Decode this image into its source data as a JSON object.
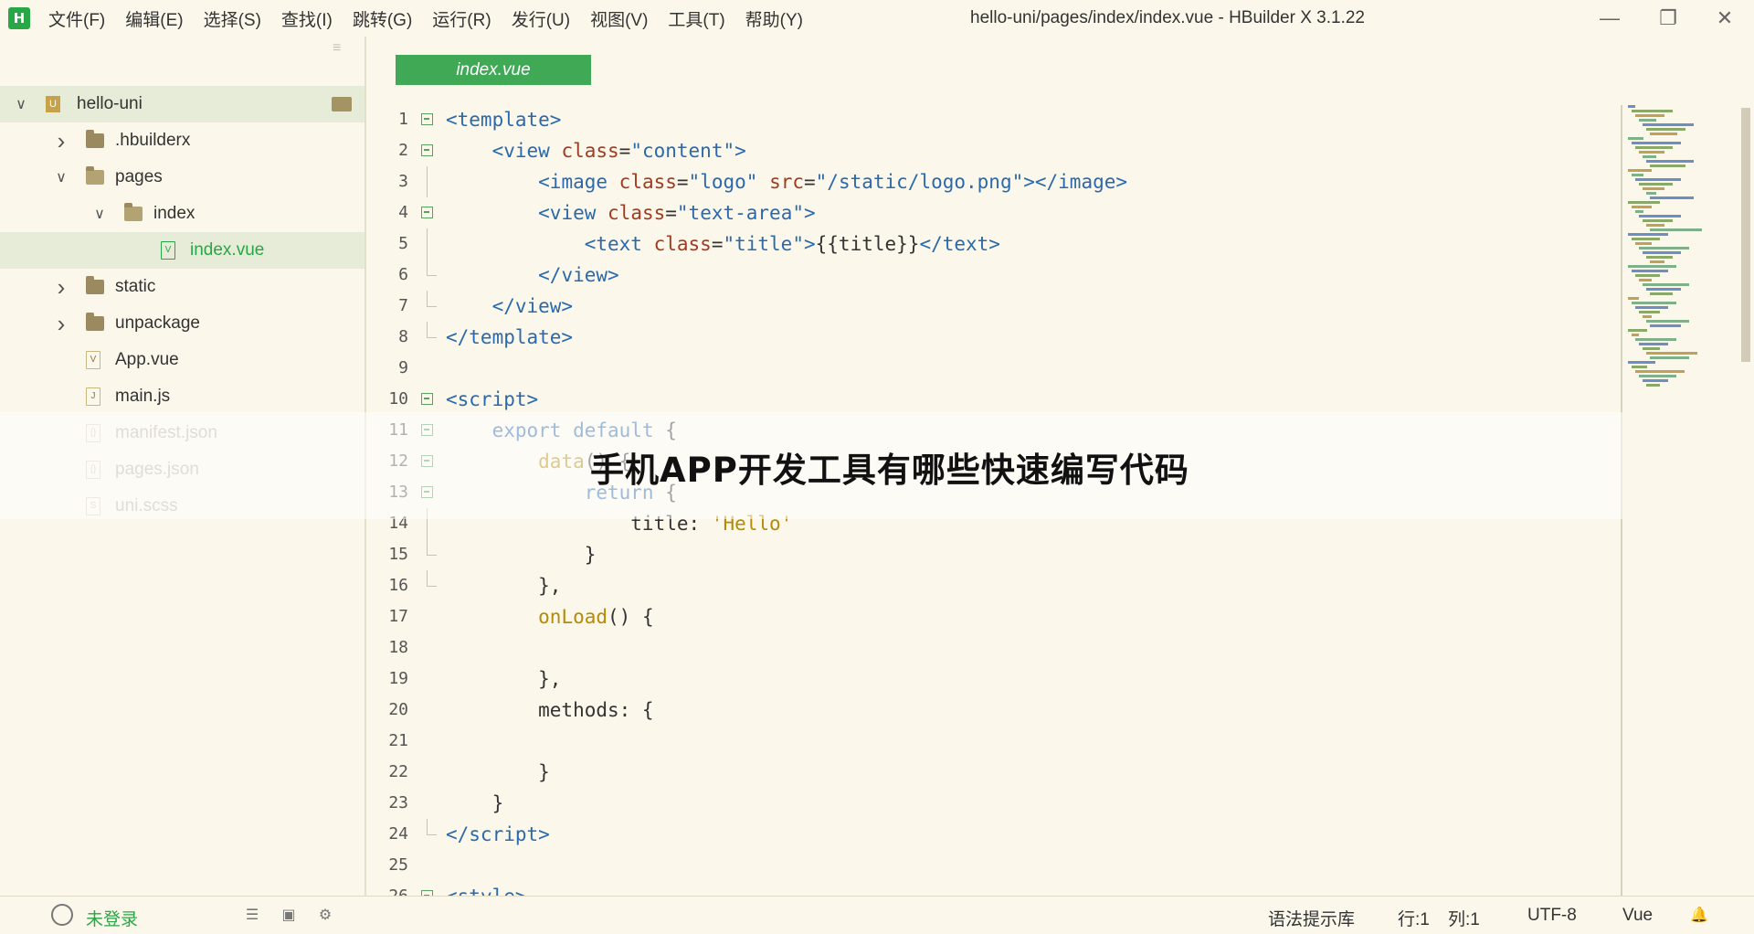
{
  "app": {
    "logo_letter": "H",
    "window_title": "hello-uni/pages/index/index.vue - HBuilder X 3.1.22"
  },
  "menu": [
    "文件(F)",
    "编辑(E)",
    "选择(S)",
    "查找(I)",
    "跳转(G)",
    "运行(R)",
    "发行(U)",
    "视图(V)",
    "工具(T)",
    "帮助(Y)"
  ],
  "window_controls": {
    "minimize_icon": "minimize-icon",
    "restore_icon": "restore-icon",
    "close_icon": "close-icon"
  },
  "sidebar": {
    "tree": [
      {
        "label": "hello-uni",
        "icon": "project-icon",
        "chevron": "chevron-down-icon",
        "depth": 0,
        "state": "active"
      },
      {
        "label": ".hbuilderx",
        "icon": "folder-icon",
        "chevron": "chevron-right-icon",
        "depth": 1
      },
      {
        "label": "pages",
        "icon": "folder-open-icon",
        "chevron": "chevron-down-icon",
        "depth": 1
      },
      {
        "label": "index",
        "icon": "folder-open-icon",
        "chevron": "chevron-down-icon",
        "depth": 2
      },
      {
        "label": "index.vue",
        "icon": "vue-file-icon",
        "depth": 3,
        "state": "selected"
      },
      {
        "label": "static",
        "icon": "folder-icon",
        "chevron": "chevron-right-icon",
        "depth": 1
      },
      {
        "label": "unpackage",
        "icon": "folder-icon",
        "chevron": "chevron-right-icon",
        "depth": 1
      },
      {
        "label": "App.vue",
        "icon": "vue-file-icon",
        "depth": 1
      },
      {
        "label": "main.js",
        "icon": "js-file-icon",
        "depth": 1
      },
      {
        "label": "manifest.json",
        "icon": "json-file-icon",
        "depth": 1,
        "state": "faded"
      },
      {
        "label": "pages.json",
        "icon": "json-file-icon",
        "depth": 1,
        "state": "faded"
      },
      {
        "label": "uni.scss",
        "icon": "scss-file-icon",
        "depth": 1,
        "state": "faded"
      }
    ]
  },
  "editor": {
    "tab_label": "index.vue",
    "lines": [
      {
        "n": "1",
        "fold": "open",
        "html": "<span class='tag'>&lt;template&gt;</span>"
      },
      {
        "n": "2",
        "fold": "open",
        "html": "    <span class='tag'>&lt;view</span> <span class='attr'>class</span>=<span class='str'>\"content\"</span><span class='tag'>&gt;</span>"
      },
      {
        "n": "3",
        "fold": "mid",
        "html": "        <span class='tag'>&lt;image</span> <span class='attr'>class</span>=<span class='str'>\"logo\"</span> <span class='attr'>src</span>=<span class='str'>\"/static/logo.png\"</span><span class='tag'>&gt;&lt;/image&gt;</span>"
      },
      {
        "n": "4",
        "fold": "open",
        "html": "        <span class='tag'>&lt;view</span> <span class='attr'>class</span>=<span class='str'>\"text-area\"</span><span class='tag'>&gt;</span>"
      },
      {
        "n": "5",
        "fold": "mid",
        "html": "            <span class='tag'>&lt;text</span> <span class='attr'>class</span>=<span class='str'>\"title\"</span><span class='tag'>&gt;</span>{{title}}<span class='tag'>&lt;/text&gt;</span>"
      },
      {
        "n": "6",
        "fold": "end",
        "html": "        <span class='tag'>&lt;/view&gt;</span>"
      },
      {
        "n": "7",
        "fold": "end",
        "html": "    <span class='tag'>&lt;/view&gt;</span>"
      },
      {
        "n": "8",
        "fold": "end",
        "html": "<span class='tag'>&lt;/template&gt;</span>"
      },
      {
        "n": "9",
        "fold": "",
        "html": ""
      },
      {
        "n": "10",
        "fold": "open",
        "html": "<span class='tag'>&lt;script&gt;</span>"
      },
      {
        "n": "11",
        "fold": "open",
        "html": "    <span class='kw'>export default</span> {"
      },
      {
        "n": "12",
        "fold": "open",
        "html": "        <span class='fn'>data</span>() {"
      },
      {
        "n": "13",
        "fold": "open",
        "html": "            <span class='kw'>return</span> {"
      },
      {
        "n": "14",
        "fold": "mid",
        "html": "                title: <span class='sq'>'Hello'</span>"
      },
      {
        "n": "15",
        "fold": "end",
        "html": "            }"
      },
      {
        "n": "16",
        "fold": "end",
        "html": "        },"
      },
      {
        "n": "17",
        "fold": "",
        "html": "        <span class='fn'>onLoad</span>() {"
      },
      {
        "n": "18",
        "fold": "",
        "html": ""
      },
      {
        "n": "19",
        "fold": "",
        "html": "        },"
      },
      {
        "n": "20",
        "fold": "",
        "html": "        methods: {"
      },
      {
        "n": "21",
        "fold": "",
        "html": ""
      },
      {
        "n": "22",
        "fold": "",
        "html": "        }"
      },
      {
        "n": "23",
        "fold": "",
        "html": "    }"
      },
      {
        "n": "24",
        "fold": "end",
        "html": "<span class='tag'>&lt;/script&gt;</span>"
      },
      {
        "n": "25",
        "fold": "",
        "html": ""
      },
      {
        "n": "26",
        "fold": "open",
        "html": "<span class='tag'>&lt;style&gt;</span>"
      }
    ]
  },
  "overlay": {
    "caption": "手机APP开发工具有哪些快速编写代码"
  },
  "statusbar": {
    "login_label": "未登录",
    "syntax_lib": "语法提示库",
    "row": "行:1",
    "col": "列:1",
    "encoding": "UTF-8",
    "language": "Vue"
  },
  "colors": {
    "accent": "#40a956",
    "background": "#fbf7ea",
    "tag": "#2a69ad",
    "attr": "#a23a21",
    "fn": "#b58a05"
  }
}
